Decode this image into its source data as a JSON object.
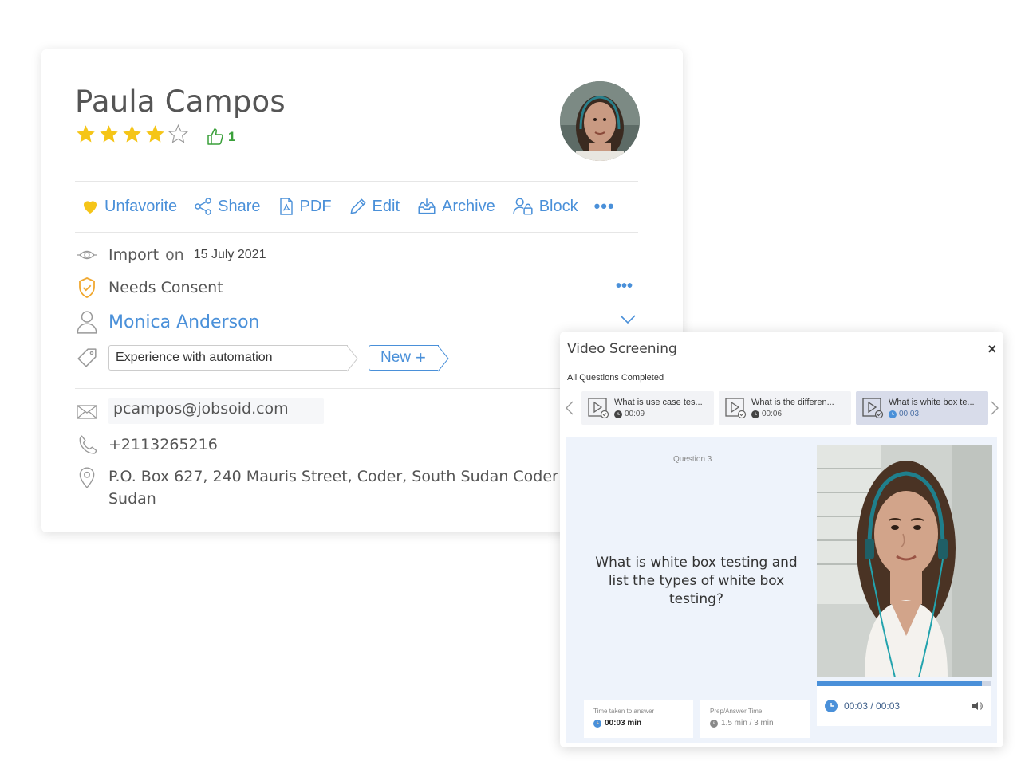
{
  "candidate": {
    "name": "Paula  Campos",
    "rating": 4,
    "rating_max": 5,
    "likes": "1",
    "actions": {
      "unfavorite": "Unfavorite",
      "share": "Share",
      "pdf": "PDF",
      "edit": "Edit",
      "archive": "Archive",
      "block": "Block",
      "more": "•••"
    },
    "source": {
      "label": "Import",
      "on": "on",
      "date": "15 July 2021"
    },
    "consent": {
      "label": "Needs Consent",
      "more": "•••"
    },
    "owner": "Monica Anderson",
    "tag": "Experience with automation",
    "new_tag": "New",
    "email": "pcampos@jobsoid.com",
    "phone": "+2113265216",
    "address": "P.O. Box 627, 240 Mauris Street, Coder, South Sudan Coder So Sudan"
  },
  "video_screening": {
    "title": "Video Screening",
    "close": "×",
    "status": "All Questions Completed",
    "questions": [
      {
        "title": "What is use case tes...",
        "duration": "00:09",
        "active": false
      },
      {
        "title": "What is the differen...",
        "duration": "00:06",
        "active": false
      },
      {
        "title": "What is white box te...",
        "duration": "00:03",
        "active": true
      }
    ],
    "current": {
      "number_label": "Question 3",
      "text": "What is white box testing and list the types of white box testing?",
      "time_taken_label": "Time taken to answer",
      "time_taken": "00:03 min",
      "prep_label": "Prep/Answer Time",
      "prep_value": "1.5 min / 3 min"
    },
    "player": {
      "time": "00:03 / 00:03",
      "progress": 0.95
    }
  },
  "colors": {
    "accent": "#4a90d9",
    "star": "#f5c518",
    "like": "#3aa03a",
    "shield": "#f0a830"
  }
}
